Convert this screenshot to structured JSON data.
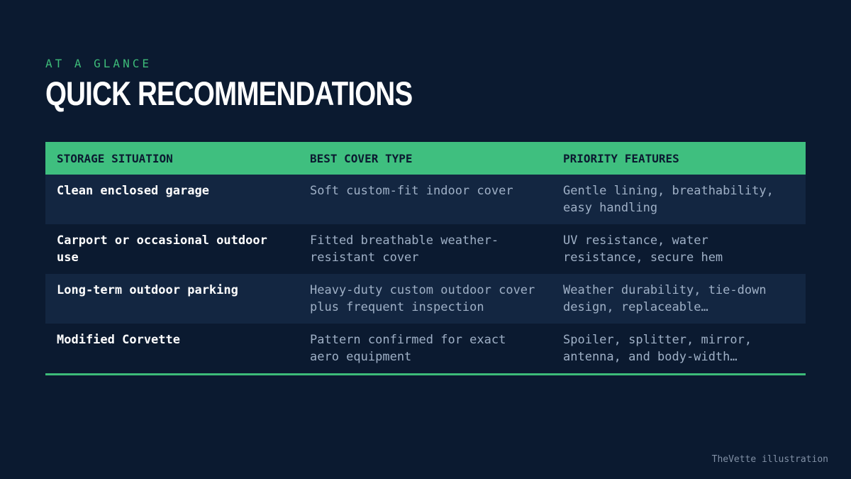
{
  "header": {
    "eyebrow": "AT A GLANCE",
    "title": "QUICK RECOMMENDATIONS"
  },
  "table": {
    "columns": [
      "STORAGE SITUATION",
      "BEST COVER TYPE",
      "PRIORITY FEATURES"
    ],
    "rows": [
      {
        "situation": "Clean enclosed garage",
        "cover": "Soft custom-fit indoor cover",
        "features": "Gentle lining, breathability, easy handling"
      },
      {
        "situation": "Carport or occasional outdoor use",
        "cover": "Fitted breathable weather-resistant cover",
        "features": "UV resistance, water resistance, secure hem"
      },
      {
        "situation": "Long-term outdoor parking",
        "cover": "Heavy-duty custom outdoor cover plus frequent inspection",
        "features": "Weather durability, tie-down design, replaceable…"
      },
      {
        "situation": "Modified Corvette",
        "cover": "Pattern confirmed for exact aero equipment",
        "features": "Spoiler, splitter, mirror, antenna, and body-width…"
      }
    ]
  },
  "footer": {
    "credit": "TheVette illustration"
  },
  "colors": {
    "background": "#0b1a30",
    "accent": "#3fbf7f",
    "row_alt": "#132641",
    "text_muted": "#9fb0c6"
  }
}
